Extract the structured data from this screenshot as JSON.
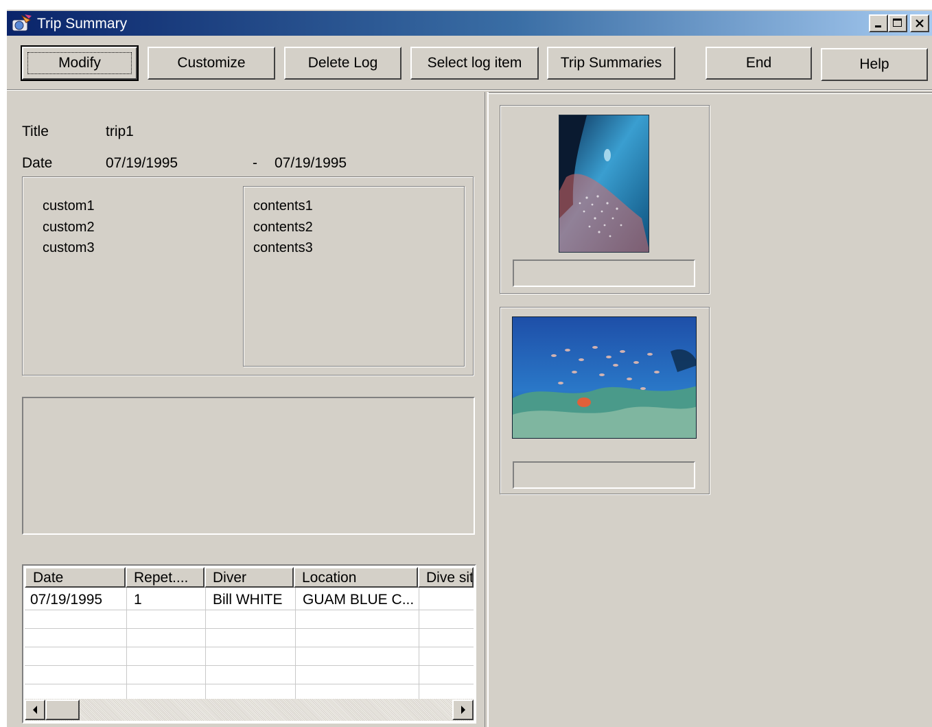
{
  "window": {
    "title": "Trip Summary"
  },
  "toolbar": {
    "modify": "Modify",
    "customize": "Customize",
    "delete_log": "Delete Log",
    "select_log_item": "Select log item",
    "trip_summaries": "Trip Summaries",
    "end": "End",
    "help": "Help"
  },
  "summary": {
    "title_label": "Title",
    "title_value": "trip1",
    "date_label": "Date",
    "date_from": "07/19/1995",
    "date_sep": "-",
    "date_to": "07/19/1995"
  },
  "custom_items": [
    "custom1",
    "custom2",
    "custom3"
  ],
  "contents_items": [
    "contents1",
    "contents2",
    "contents3"
  ],
  "log_table": {
    "columns": [
      "Date",
      "Repet....",
      "Diver",
      "Location",
      "Dive sit"
    ],
    "rows": [
      [
        "07/19/1995",
        "1",
        "Bill WHITE",
        "GUAM BLUE C...",
        ""
      ]
    ]
  },
  "photos": [
    {
      "caption": ""
    },
    {
      "caption": ""
    }
  ]
}
